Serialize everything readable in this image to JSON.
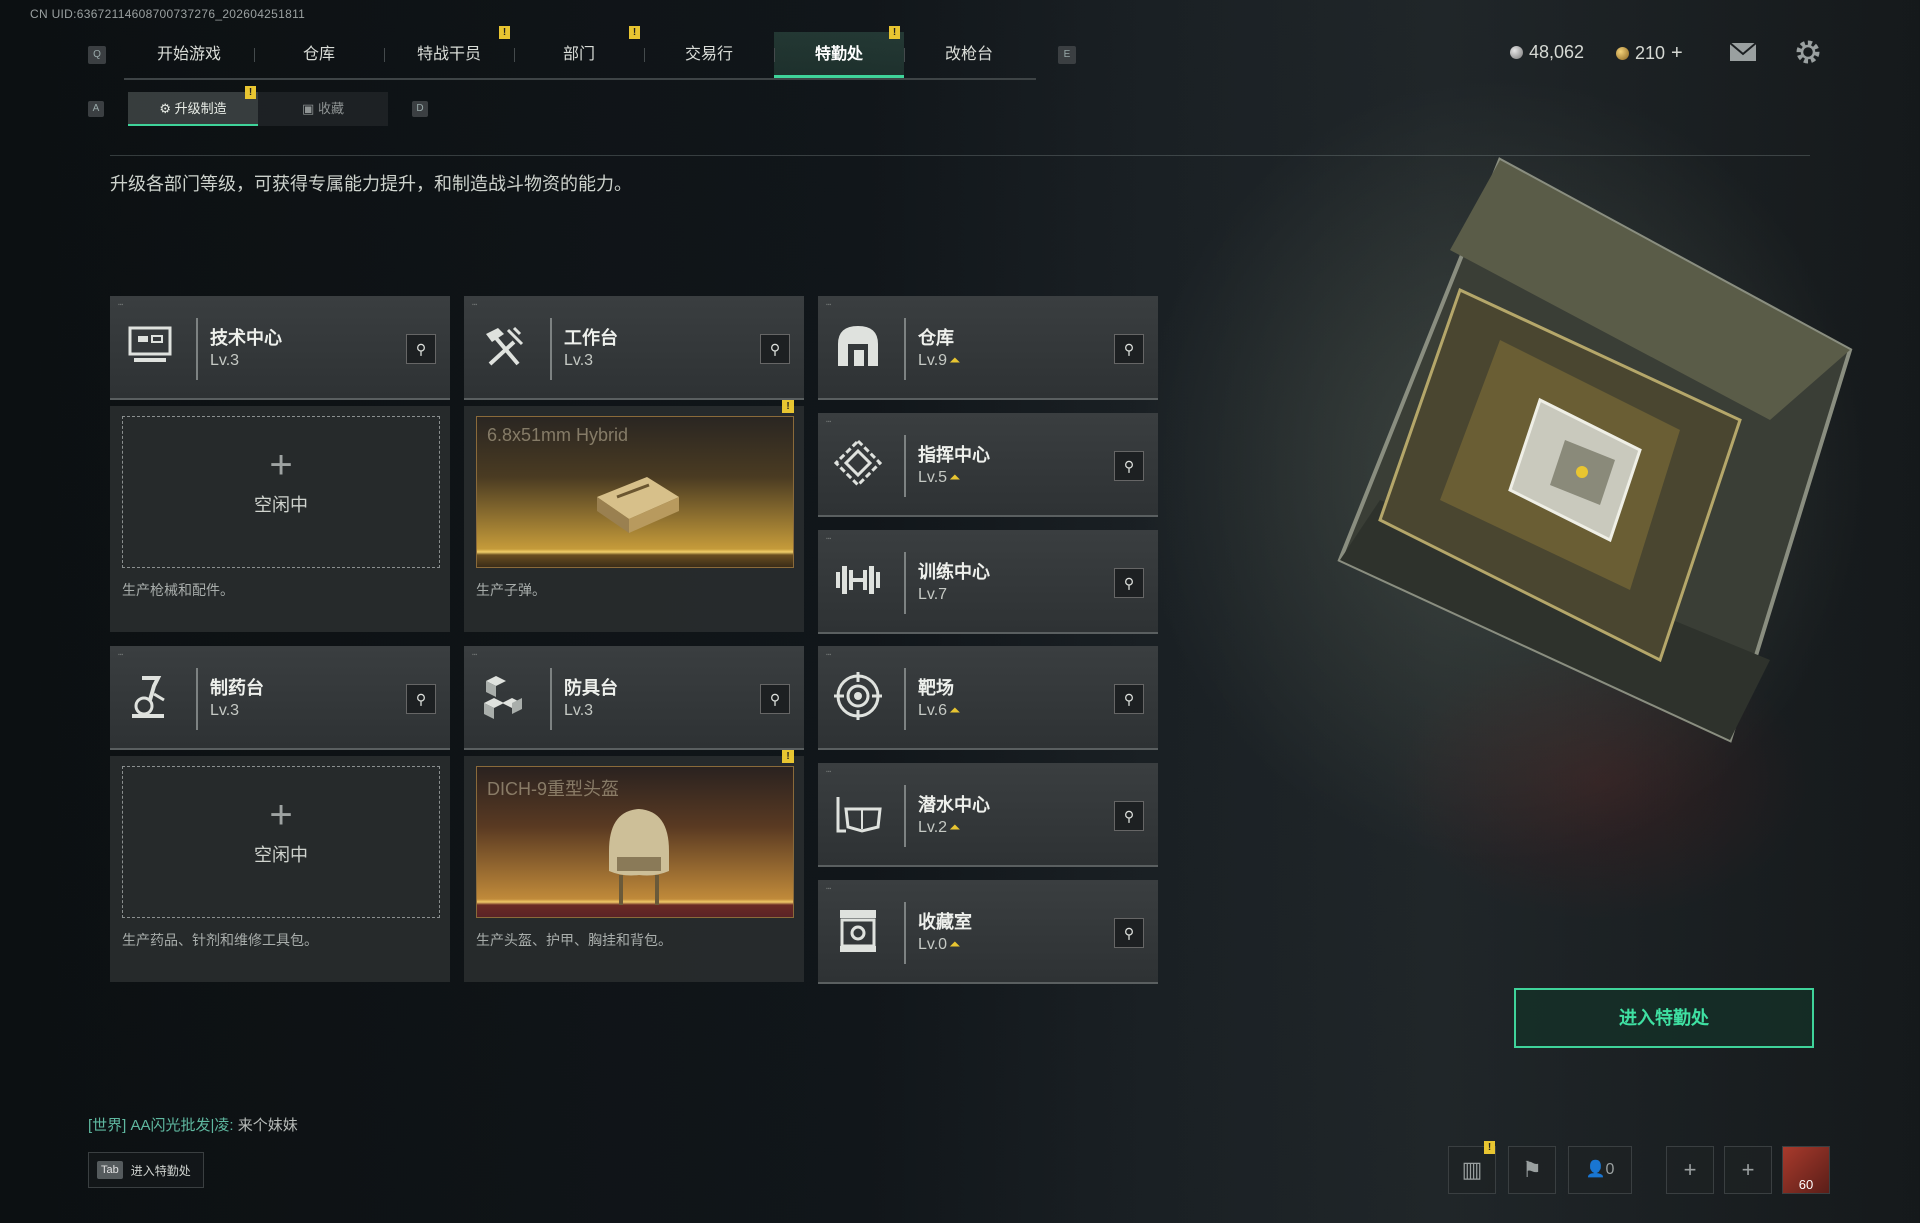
{
  "uid_text": "CN UID:6367211460870073727​6_202604251811",
  "nav": {
    "left_key": "Q",
    "right_key": "E",
    "tabs": [
      {
        "label": "开始游戏",
        "badge": ""
      },
      {
        "label": "仓库",
        "badge": ""
      },
      {
        "label": "特战干员",
        "badge": "!"
      },
      {
        "label": "部门",
        "badge": "!"
      },
      {
        "label": "交易行",
        "badge": ""
      },
      {
        "label": "特勤处",
        "badge": "!",
        "active": true
      },
      {
        "label": "改枪台",
        "badge": ""
      }
    ]
  },
  "subnav": {
    "left_key": "A",
    "right_key": "D",
    "tabs": [
      {
        "label": "升级制造",
        "badge": "!",
        "active": true
      },
      {
        "label": "收藏",
        "badge": ""
      }
    ]
  },
  "description": "升级各部门等级，可获得专属能力提升，和制造战斗物资的能力。",
  "currency": {
    "silver": "48,062",
    "gold": "210",
    "plus": "+"
  },
  "stations": [
    {
      "name": "技术中心",
      "level": "Lv.3",
      "upgrade": false,
      "icon": "tech-center-icon",
      "status": "空闲中",
      "status_icon": "+",
      "desc": "生产枪械和配件。"
    },
    {
      "name": "工作台",
      "level": "Lv.3",
      "upgrade": false,
      "icon": "workbench-icon",
      "product": "6.8x51mm Hybrid",
      "desc": "生产子弹。"
    },
    {
      "name": "制药台",
      "level": "Lv.3",
      "upgrade": false,
      "icon": "pharmacy-icon",
      "status": "空闲中",
      "status_icon": "+",
      "desc": "生产药品、针剂和维修工具包。"
    },
    {
      "name": "防具台",
      "level": "Lv.3",
      "upgrade": false,
      "icon": "armor-bench-icon",
      "product": "DICH-9重型头盔",
      "desc": "生产头盔、护甲、胸挂和背包。"
    }
  ],
  "departments": [
    {
      "name": "仓库",
      "level": "Lv.9",
      "upgrade": true,
      "icon": "warehouse-icon"
    },
    {
      "name": "指挥中心",
      "level": "Lv.5",
      "upgrade": true,
      "icon": "command-center-icon"
    },
    {
      "name": "训练中心",
      "level": "Lv.7",
      "upgrade": false,
      "icon": "training-center-icon"
    },
    {
      "name": "靶场",
      "level": "Lv.6",
      "upgrade": true,
      "icon": "shooting-range-icon"
    },
    {
      "name": "潜水中心",
      "level": "Lv.2",
      "upgrade": true,
      "icon": "diving-center-icon"
    },
    {
      "name": "收藏室",
      "level": "Lv.0",
      "upgrade": true,
      "icon": "collection-room-icon"
    }
  ],
  "enter_button": "进入特勤处",
  "chat": {
    "channel": "[世界]",
    "user": "AA闪光批发|凌:",
    "message": "来个妹妹"
  },
  "tab_hint": {
    "key": "Tab",
    "label": "进入特勤处"
  },
  "bottom_bar": {
    "friends_count": "0",
    "avatar_level": "60"
  },
  "colors": {
    "accent": "#3fd39a",
    "badge": "#e8c531",
    "upgrade_arrow": "#e8c531"
  }
}
